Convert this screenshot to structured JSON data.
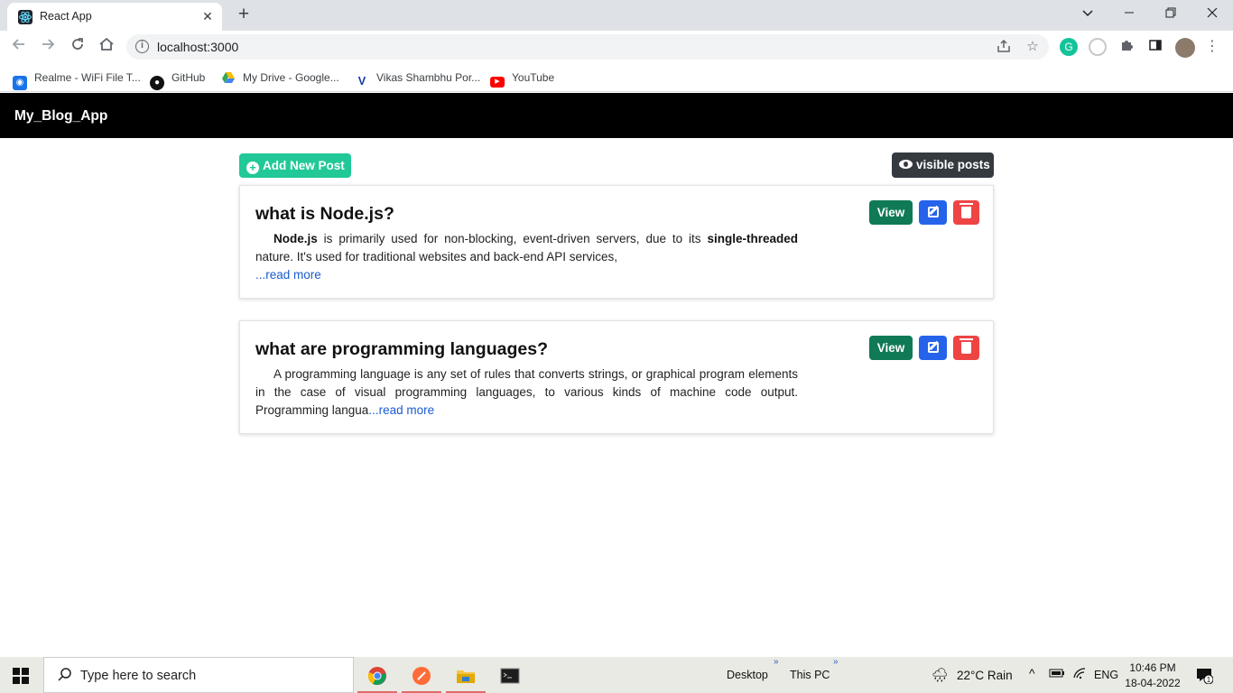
{
  "browser": {
    "tab_title": "React App",
    "tab_close": "✕",
    "new_tab": "+",
    "url": "localhost:3000",
    "bookmarks": [
      {
        "label": "Realme - WiFi File T...",
        "icon": "wifi-icon",
        "color": "#1a73e8"
      },
      {
        "label": "GitHub",
        "icon": "github-icon",
        "color": "#111111"
      },
      {
        "label": "My Drive - Google...",
        "icon": "google-drive-icon",
        "color": "#34a853"
      },
      {
        "label": "Vikas Shambhu Por...",
        "icon": "v-logo-icon",
        "color": "#1a3fa6"
      },
      {
        "label": "YouTube",
        "icon": "youtube-icon",
        "color": "#ff0000"
      }
    ]
  },
  "app": {
    "brand": "My_Blog_App",
    "add_button": "Add New Post",
    "visible_button": "visible posts",
    "posts": [
      {
        "title": "what is Node.js?",
        "body_bold_1": "Node.js",
        "body_1": " is primarily used for non-blocking, event-driven servers, due to its ",
        "body_bold_2": "single-threaded",
        "body_2": " nature. It's used for traditional websites and back-end API services,",
        "read_more": "...read more",
        "view_label": "View"
      },
      {
        "title": "what are programming languages?",
        "body": "A programming language is any set of rules that converts strings, or graphical program elements in the case of visual programming languages, to various kinds of machine code output. Programming langua",
        "read_more": "...read more",
        "view_label": "View"
      }
    ]
  },
  "taskbar": {
    "search_placeholder": "Type here to search",
    "desktop": "Desktop",
    "this_pc": "This PC",
    "chevrons": "»",
    "weather": "22°C  Rain",
    "language": "ENG",
    "time": "10:46 PM",
    "date": "18-04-2022",
    "notifications": "1"
  },
  "colors": {
    "add": "#20c997",
    "visible": "#343a40",
    "view": "#0f7a55",
    "edit": "#2563eb",
    "delete": "#ef4444",
    "link": "#1a5bd0"
  }
}
